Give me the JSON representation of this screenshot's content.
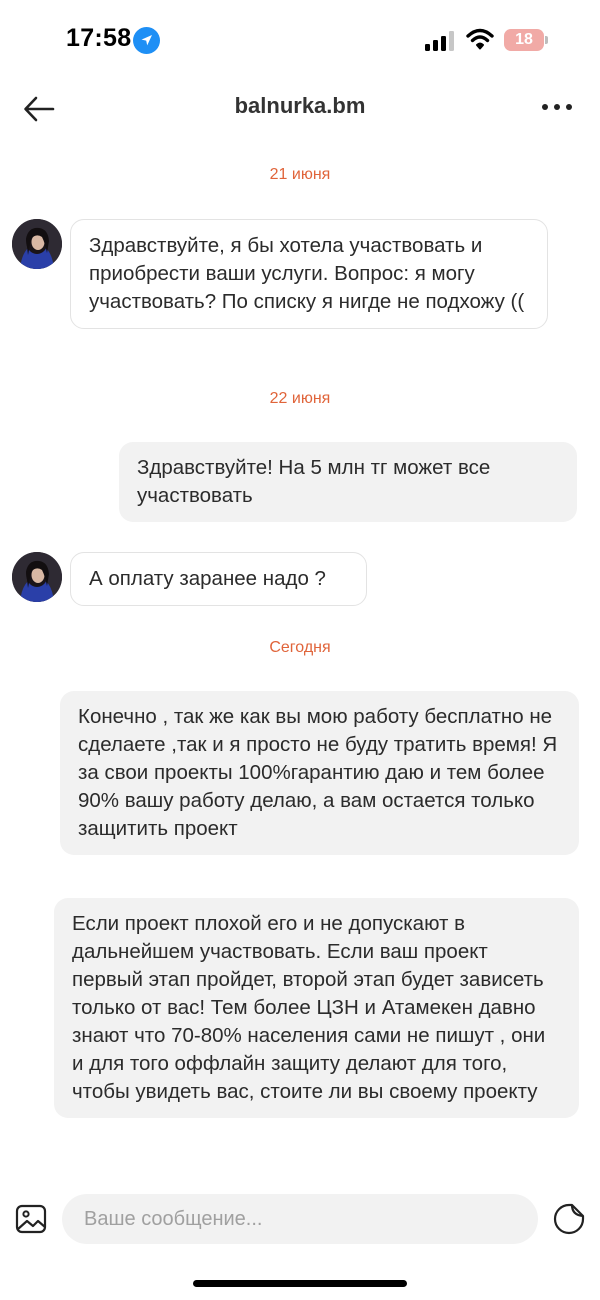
{
  "status_bar": {
    "time": "17:58",
    "battery": "18"
  },
  "header": {
    "title": "balnurka.bm"
  },
  "dates": [
    "21 июня",
    "22 июня",
    "Сегодня"
  ],
  "messages": [
    {
      "direction": "incoming",
      "text": "Здравствуйте, я бы хотела участвовать и приобрести ваши услуги. Вопрос: я могу участвовать? По списку я нигде не подхожу (("
    },
    {
      "direction": "outgoing",
      "text": "Здравствуйте! На 5 млн тг может все участвовать"
    },
    {
      "direction": "incoming",
      "text": "А оплату заранее надо ?"
    },
    {
      "direction": "outgoing",
      "text": "Конечно , так же как вы мою работу бесплатно не сделаете ,так и я просто не буду тратить время! Я за свои проекты 100%гарантию даю и тем более 90% вашу работу делаю, а вам остается только защитить проект"
    },
    {
      "direction": "outgoing",
      "text": "Если проект плохой его и не допускают в дальнейшем участвовать. Если ваш проект первый этап пройдет, второй этап будет зависеть только от вас! Тем более ЦЗН и Атамекен давно знают что 70-80% населения сами не пишут , они и для того оффлайн защиту делают для того, чтобы увидеть вас, стоите ли вы своему проекту"
    }
  ],
  "composer": {
    "placeholder": "Ваше сообщение..."
  },
  "colors": {
    "date_accent": "#e0643a",
    "location_badge": "#1e8ff5",
    "battery_low": "#f1aaa6",
    "outgoing_bubble": "#f2f2f2"
  },
  "icons": {
    "back": "arrow-left-icon",
    "more": "more-horizontal-icon",
    "gallery": "image-icon",
    "sticker": "sticker-icon",
    "location": "location-arrow-icon",
    "signal": "cellular-signal-icon",
    "wifi": "wifi-icon"
  }
}
